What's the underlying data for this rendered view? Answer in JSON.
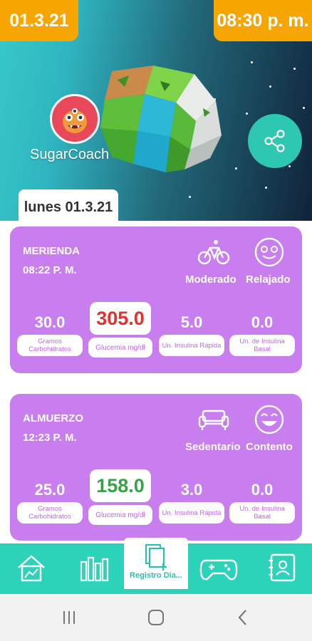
{
  "header": {
    "date": "01.3.21",
    "time": "08:30 p. m.",
    "brand": "SugarCoach",
    "day_label": "lunes 01.3.21"
  },
  "entries": [
    {
      "meal": "MERIENDA",
      "time": "08:22 P. M.",
      "activity": "Moderado",
      "mood": "Relajado",
      "carbs": "30.0",
      "carbs_label": "Gramos Carbohidratos",
      "glucose": "305.0",
      "glucose_label": "Glucemia mg/dl",
      "glucose_color": "#e0322f",
      "rapid": "5.0",
      "rapid_label": "Un. Insulina Rápida",
      "basal": "0.0",
      "basal_label": "Un. de Insulina Basal"
    },
    {
      "meal": "ALMUERZO",
      "time": "12:23 P. M.",
      "activity": "Sedentario",
      "mood": "Contento",
      "carbs": "25.0",
      "carbs_label": "Gramos Carbohidratos",
      "glucose": "158.0",
      "glucose_label": "Glucemia mg/dl",
      "glucose_color": "#3aa14a",
      "rapid": "3.0",
      "rapid_label": "Un. Insulina Rápida",
      "basal": "0.0",
      "basal_label": "Un. de Insulina Basal"
    }
  ],
  "nav": {
    "items": [
      "home-icon",
      "stats-icon",
      "diary-icon",
      "gamepad-icon",
      "contacts-icon"
    ],
    "active_label": "Registro Dia..."
  },
  "colors": {
    "accent_orange": "#f7a500",
    "card_purple": "#c97ef0",
    "nav_teal": "#2cd3b9"
  }
}
